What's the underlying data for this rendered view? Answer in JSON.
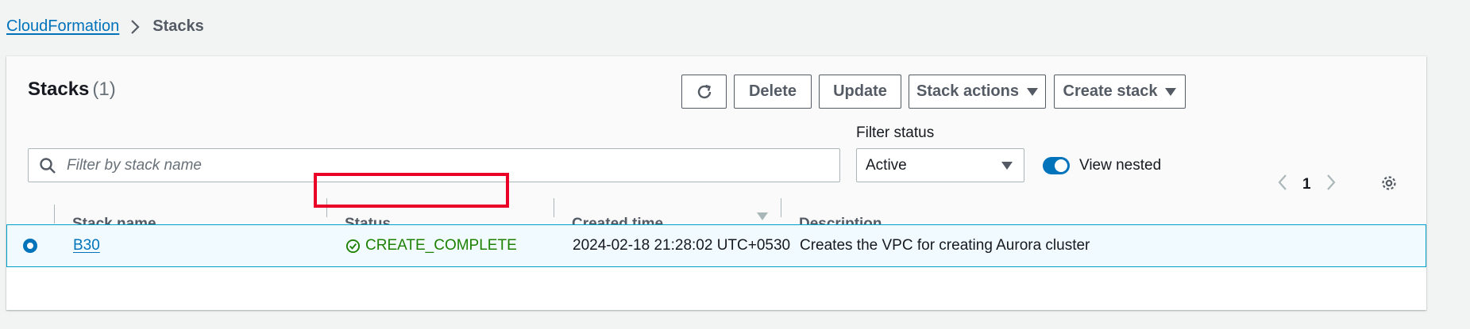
{
  "breadcrumb": {
    "root": "CloudFormation",
    "current": "Stacks"
  },
  "panel": {
    "title": "Stacks",
    "count": "(1)",
    "buttons": {
      "delete": "Delete",
      "update": "Update",
      "stack_actions": "Stack actions",
      "create_stack": "Create stack"
    },
    "search": {
      "placeholder": "Filter by stack name"
    },
    "filter": {
      "label": "Filter status",
      "value": "Active"
    },
    "toggle": {
      "label": "View nested",
      "on": true
    },
    "pagination": {
      "page": "1"
    }
  },
  "table": {
    "columns": [
      "Stack name",
      "Status",
      "Created time",
      "Description"
    ],
    "rows": [
      {
        "name": "B30",
        "status": "CREATE_COMPLETE",
        "created": "2024-02-18 21:28:02 UTC+0530",
        "description": "Creates the VPC for creating Aurora cluster"
      }
    ]
  },
  "colors": {
    "link": "#0073bb",
    "success": "#1d8102",
    "highlight": "#ea0027"
  },
  "icons": [
    "chevron-right-icon",
    "refresh-icon",
    "caret-down-icon",
    "search-icon",
    "chevron-left-icon",
    "settings-icon",
    "radio-selected-icon",
    "status-success-icon",
    "sort-desc-icon"
  ]
}
